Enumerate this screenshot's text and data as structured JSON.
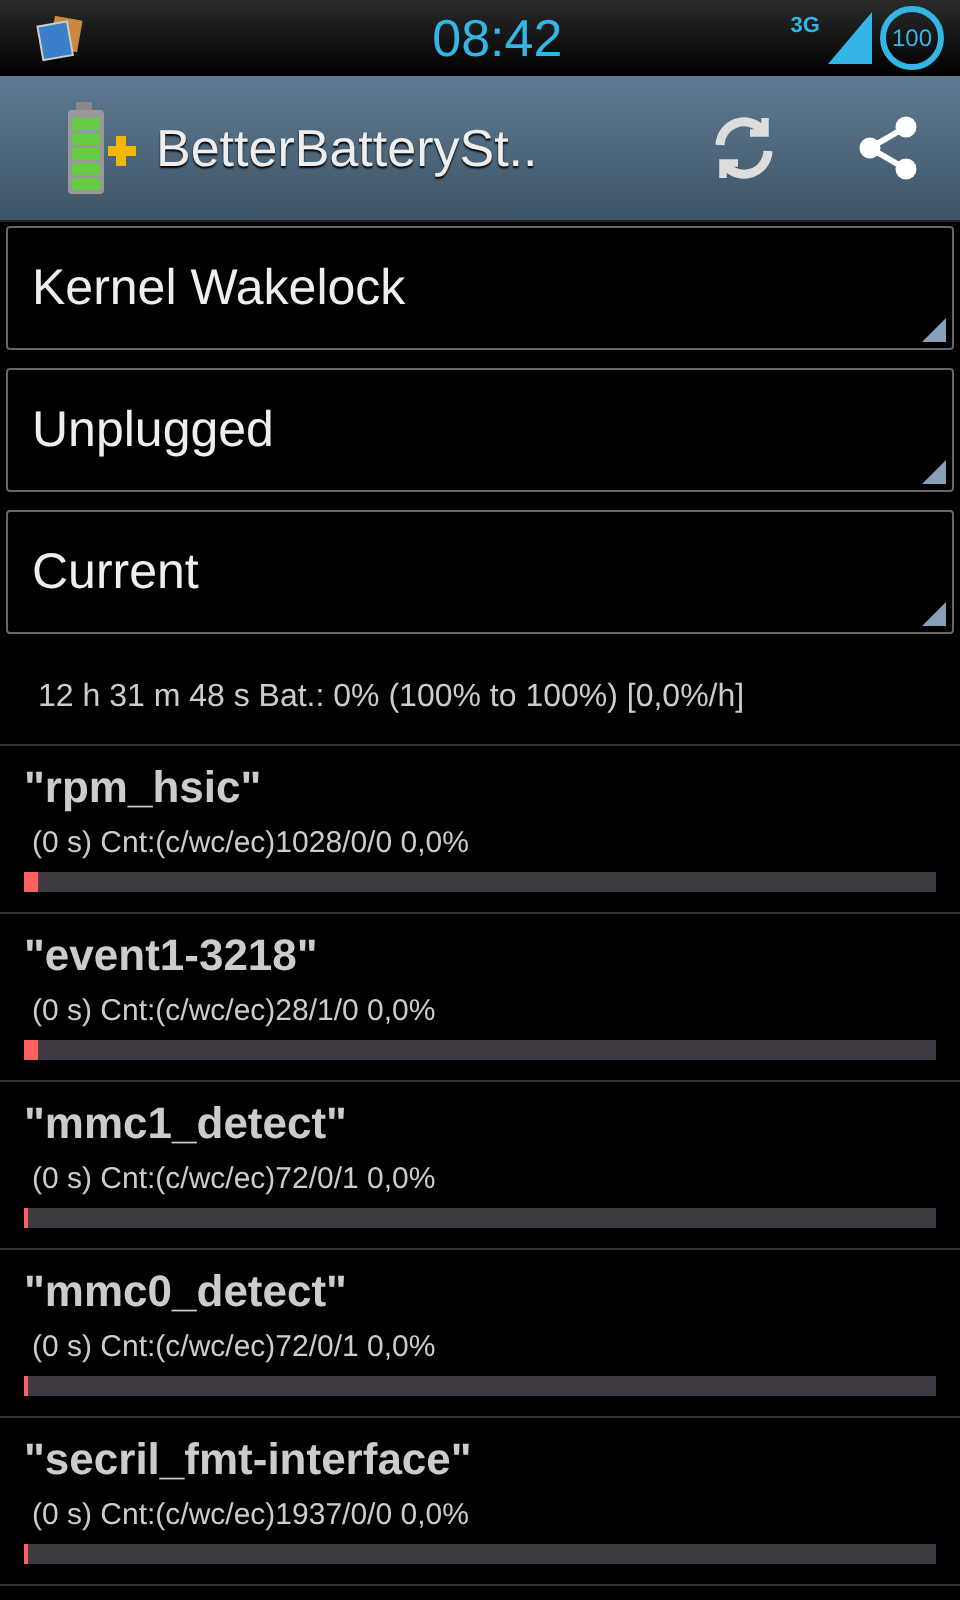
{
  "status_bar": {
    "time": "08:42",
    "network": "3G",
    "battery": "100"
  },
  "action_bar": {
    "title": "BetterBatterySt.."
  },
  "spinners": [
    "Kernel Wakelock",
    "Unplugged",
    "Current"
  ],
  "summary": "12 h 31 m 48 s  Bat.: 0% (100% to 100%) [0,0%/h]",
  "wakelocks": [
    {
      "name": "\"rpm_hsic\"",
      "detail": "(0 s) Cnt:(c/wc/ec)1028/0/0 0,0%",
      "level": 0.015
    },
    {
      "name": "\"event1-3218\"",
      "detail": "(0 s) Cnt:(c/wc/ec)28/1/0 0,0%",
      "level": 0.015
    },
    {
      "name": "\"mmc1_detect\"",
      "detail": "(0 s) Cnt:(c/wc/ec)72/0/1 0,0%",
      "level": 0.004
    },
    {
      "name": "\"mmc0_detect\"",
      "detail": "(0 s) Cnt:(c/wc/ec)72/0/1 0,0%",
      "level": 0.004
    },
    {
      "name": "\"secril_fmt-interface\"",
      "detail": "(0 s) Cnt:(c/wc/ec)1937/0/0 0,0%",
      "level": 0.004
    }
  ]
}
